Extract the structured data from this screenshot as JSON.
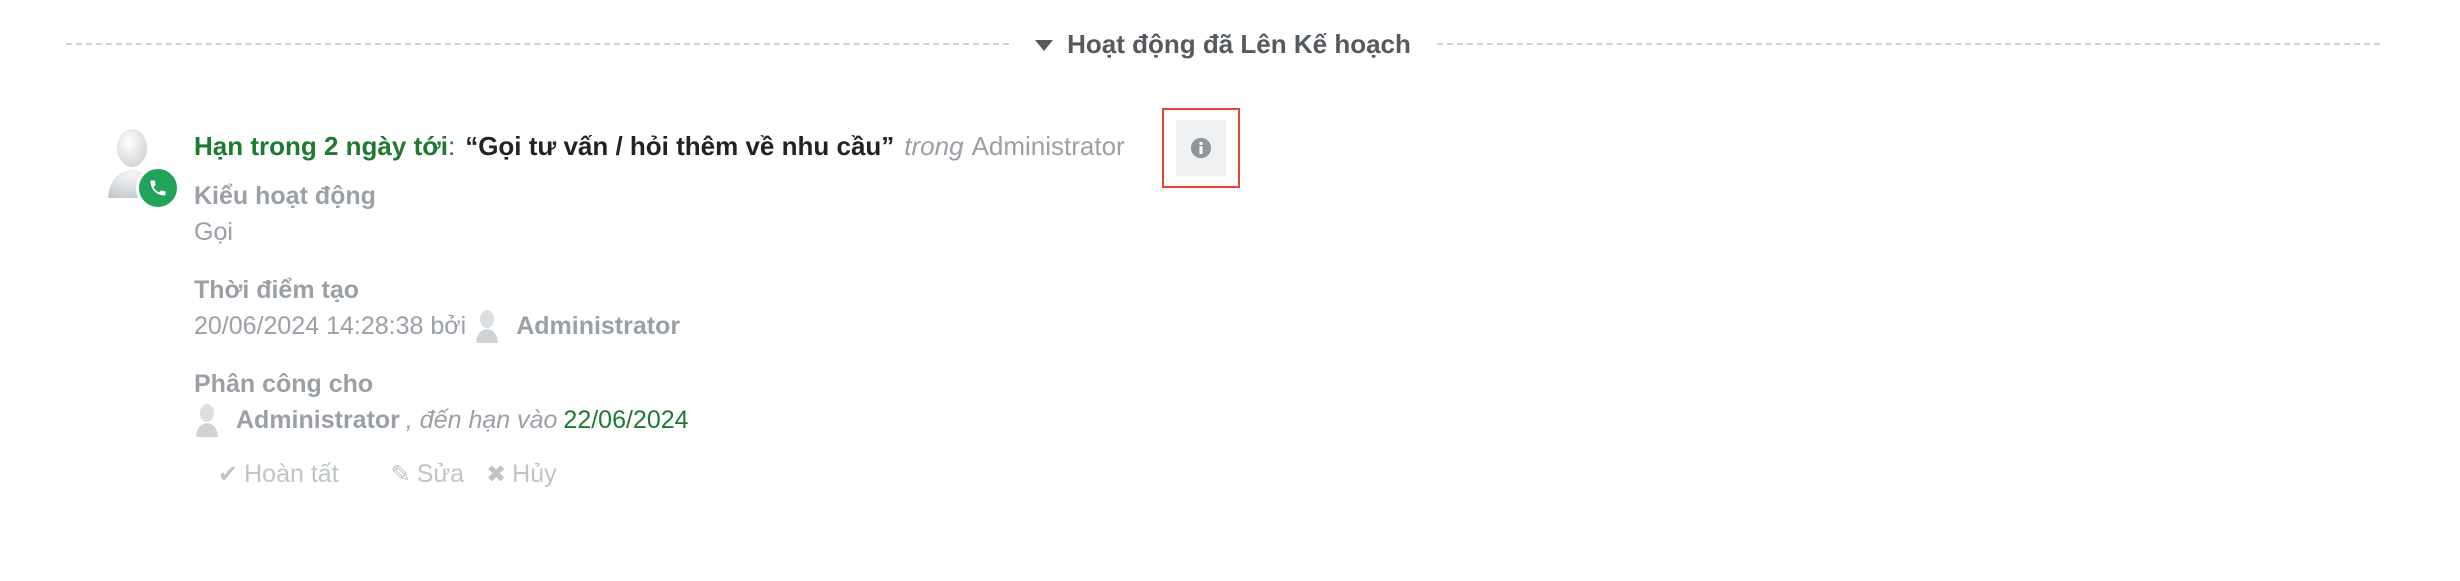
{
  "section": {
    "title": "Hoạt động đã Lên Kế hoạch"
  },
  "activity": {
    "due_label": "Hạn trong 2 ngày tới",
    "colon": ":",
    "summary": "“Gọi tư vấn / hỏi thêm về nhu cầu”",
    "in_word": "trong",
    "record": "Administrator",
    "fields": {
      "type_label": "Kiểu hoạt động",
      "type_value": "Gọi",
      "created_label": "Thời điểm tạo",
      "created_value": "20/06/2024 14:28:38 bởi",
      "created_by": "Administrator",
      "assigned_label": "Phân công cho",
      "assigned_to": "Administrator",
      "due_prefix": ", đến hạn vào",
      "due_date": "22/06/2024"
    },
    "actions": {
      "done": "Hoàn tất",
      "edit": "Sửa",
      "cancel": "Hủy"
    }
  },
  "colors": {
    "accent_green": "#1e7a2e",
    "badge_green": "#21a35a",
    "highlight_red": "#e3472f",
    "muted_text": "#9aa0a6"
  },
  "icons": {
    "caret": "caret-down-icon",
    "avatar": "user-avatar-icon",
    "badge": "phone-icon",
    "info": "info-icon",
    "done": "check-icon",
    "edit": "pencil-icon",
    "cancel": "times-icon"
  }
}
